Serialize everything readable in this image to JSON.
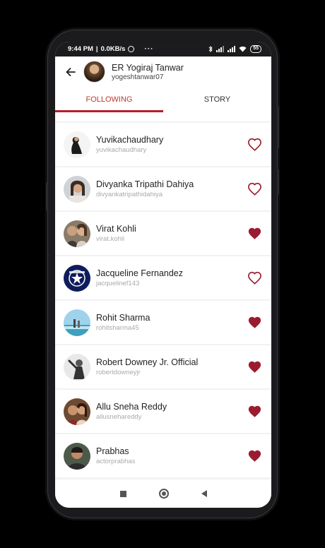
{
  "status_bar": {
    "time": "9:44 PM",
    "speed": "0.0KB/s",
    "more": "···",
    "battery": "55"
  },
  "header": {
    "name": "ER Yogiraj Tanwar",
    "username": "yogeshtanwar07"
  },
  "tabs": [
    {
      "label": "FOLLOWING",
      "active": true
    },
    {
      "label": "STORY",
      "active": false
    }
  ],
  "following": [
    {
      "name": "Yuvikachaudhary",
      "username": "yuvikachaudhary",
      "liked": false
    },
    {
      "name": "Divyanka Tripathi Dahiya",
      "username": "divyankatripathidahiya",
      "liked": false
    },
    {
      "name": "Virat Kohli",
      "username": "virat.kohli",
      "liked": true
    },
    {
      "name": "Jacqueline Fernandez",
      "username": "jacquelinef143",
      "liked": false
    },
    {
      "name": "Rohit Sharma",
      "username": "rohitsharma45",
      "liked": true
    },
    {
      "name": "Robert Downey Jr. Official",
      "username": "robertdowneyjr",
      "liked": true
    },
    {
      "name": "Allu Sneha Reddy",
      "username": "allusnehareddy",
      "liked": true
    },
    {
      "name": "Prabhas",
      "username": "actorprabhas",
      "liked": true
    }
  ],
  "colors": {
    "accent": "#b71c2b",
    "heart": "#9b1b30"
  }
}
